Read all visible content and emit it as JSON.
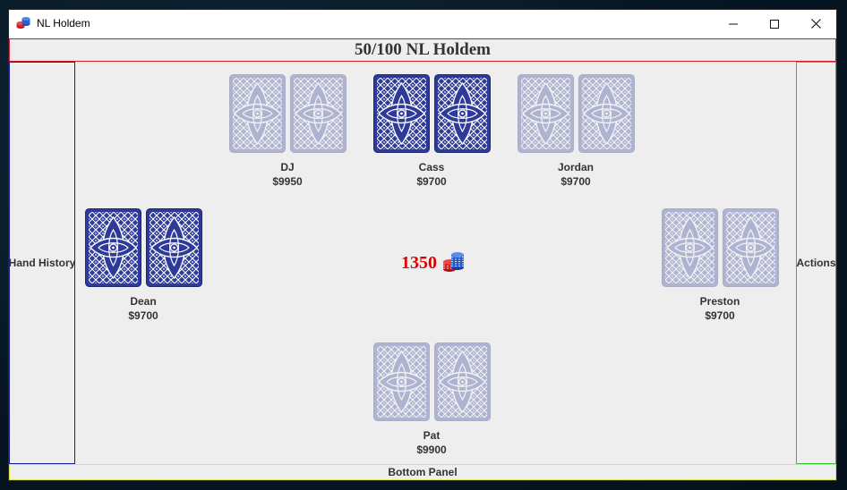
{
  "window": {
    "title": "NL Holdem",
    "icon": "poker-chips-icon"
  },
  "header": {
    "title": "50/100 NL Holdem"
  },
  "left_panel": {
    "label": "Hand History"
  },
  "right_panel": {
    "label": "Actions"
  },
  "bottom_panel": {
    "label": "Bottom Panel"
  },
  "colors": {
    "header_border": "#d21e2a",
    "left_border": "#1b1b9a",
    "right_border": "#2fc42f",
    "bottom_border": "#e6e64a",
    "card_back": "#2d3a99",
    "pot_text": "#e00000"
  },
  "pot": {
    "amount": "1350",
    "icon": "chip-stack-icon"
  },
  "players": [
    {
      "name": "DJ",
      "stack": "$9950",
      "active": false
    },
    {
      "name": "Cass",
      "stack": "$9700",
      "active": true
    },
    {
      "name": "Jordan",
      "stack": "$9700",
      "active": false
    },
    {
      "name": "Dean",
      "stack": "$9700",
      "active": true
    },
    {
      "name": "Preston",
      "stack": "$9700",
      "active": false
    },
    {
      "name": "Pat",
      "stack": "$9900",
      "active": false
    }
  ]
}
